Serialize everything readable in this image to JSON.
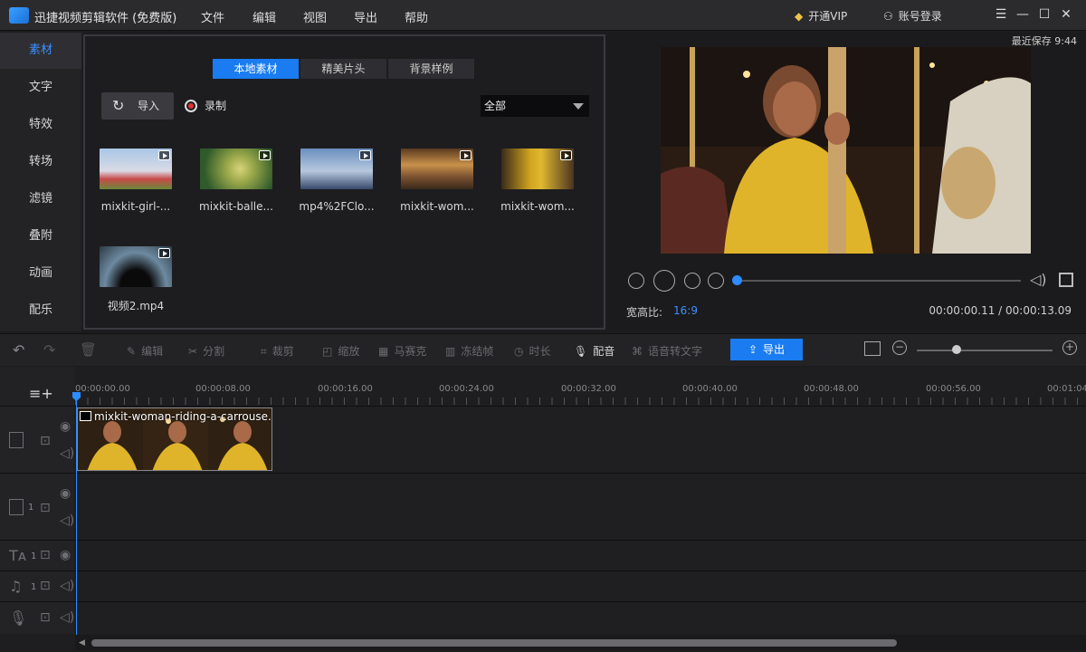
{
  "app": {
    "title": "迅捷视频剪辑软件 (免费版)"
  },
  "menu": [
    "文件",
    "编辑",
    "视图",
    "导出",
    "帮助"
  ],
  "header_right": {
    "vip": "开通VIP",
    "login": "账号登录"
  },
  "sidebar": {
    "items": [
      "素材",
      "文字",
      "特效",
      "转场",
      "滤镜",
      "叠附",
      "动画",
      "配乐"
    ],
    "active": 0
  },
  "media_panel": {
    "tabs": [
      "本地素材",
      "精美片头",
      "背景样例"
    ],
    "import_label": "导入",
    "record_label": "录制",
    "filter_value": "全部",
    "items": [
      {
        "name": "mixkit-girl-..."
      },
      {
        "name": "mixkit-balle..."
      },
      {
        "name": "mp4%2FClo..."
      },
      {
        "name": "mixkit-wom..."
      },
      {
        "name": "mixkit-wom..."
      },
      {
        "name": "视频2.mp4"
      }
    ]
  },
  "preview": {
    "saved_text": "最近保存 9:44",
    "aspect_label": "宽高比:",
    "aspect_value": "16:9",
    "timecode": "00:00:00.11 / 00:00:13.09",
    "progress": 0.01
  },
  "toolbar": {
    "tools": [
      "编辑",
      "分割",
      "裁剪",
      "缩放",
      "马赛克",
      "冻结帧",
      "时长",
      "配音",
      "语音转文字"
    ],
    "export_label": "导出"
  },
  "timeline": {
    "ruler_labels": [
      "00:00:00.00",
      "00:00:08.00",
      "00:00:16.00",
      "00:00:24.00",
      "00:00:32.00",
      "00:00:40.00",
      "00:00:48.00",
      "00:00:56.00",
      "00:01:04"
    ],
    "clip_title": "mixkit-woman-riding-a-carrouse...",
    "track_numbers": [
      "1",
      "1",
      "1"
    ]
  },
  "colors": {
    "accent": "#1a7cf0",
    "record_dot": "#e53030",
    "vip_gem": "#f0c248"
  }
}
